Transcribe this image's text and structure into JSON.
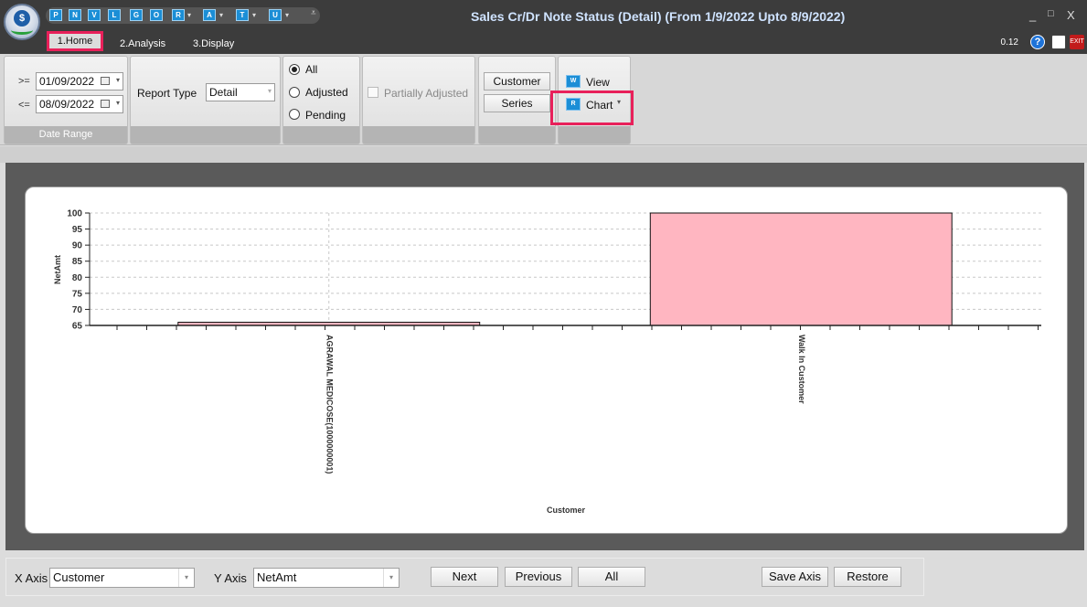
{
  "window": {
    "title": "Sales Cr/Dr Note Status (Detail)  (From 1/9/2022 Upto 8/9/2022)",
    "logo_letter": "$",
    "version": "0.12",
    "minimize": "_",
    "restore": "□",
    "close": "X"
  },
  "quick_access": [
    "P",
    "N",
    "V",
    "L",
    "G",
    "O",
    "R",
    "A",
    "T",
    "U"
  ],
  "tabs": [
    {
      "label": "1.Home",
      "active": true
    },
    {
      "label": "2.Analysis",
      "active": false
    },
    {
      "label": "3.Display",
      "active": false
    }
  ],
  "date_range": {
    "from_op": ">=",
    "from_value": "01/09/2022",
    "to_op": "<=",
    "to_value": "08/09/2022",
    "group_label": "Date Range"
  },
  "report_type": {
    "label": "Report Type",
    "value": "Detail"
  },
  "status_filter": {
    "options": [
      "All",
      "Adjusted",
      "Pending"
    ],
    "selected": "All"
  },
  "partially_adjusted": {
    "label": "Partially Adjusted",
    "checked": false
  },
  "group_buttons": {
    "customer": "Customer",
    "series": "Series"
  },
  "view_buttons": {
    "view": "View",
    "chart": "Chart"
  },
  "chart_data": {
    "type": "bar",
    "categories": [
      "AGRAWAL MEDICOSE(1000000001)",
      "Walk In Customer"
    ],
    "values": [
      66,
      100
    ],
    "xlabel": "Customer",
    "ylabel": "NetAmt",
    "ylim": [
      65,
      100
    ],
    "yticks": [
      65,
      70,
      75,
      80,
      85,
      90,
      95,
      100
    ],
    "bar_color": "#ffb6c1",
    "grid": true
  },
  "bottom_bar": {
    "x_axis_label": "X Axis",
    "x_axis_value": "Customer",
    "y_axis_label": "Y Axis",
    "y_axis_value": "NetAmt",
    "next": "Next",
    "previous": "Previous",
    "all": "All",
    "save_axis": "Save Axis",
    "restore": "Restore"
  },
  "colors": {
    "titlebar": "#3c3c3c",
    "title_text": "#cfe3ff",
    "highlight": "#e8205a",
    "icon_blue": "#1b8ed6"
  }
}
